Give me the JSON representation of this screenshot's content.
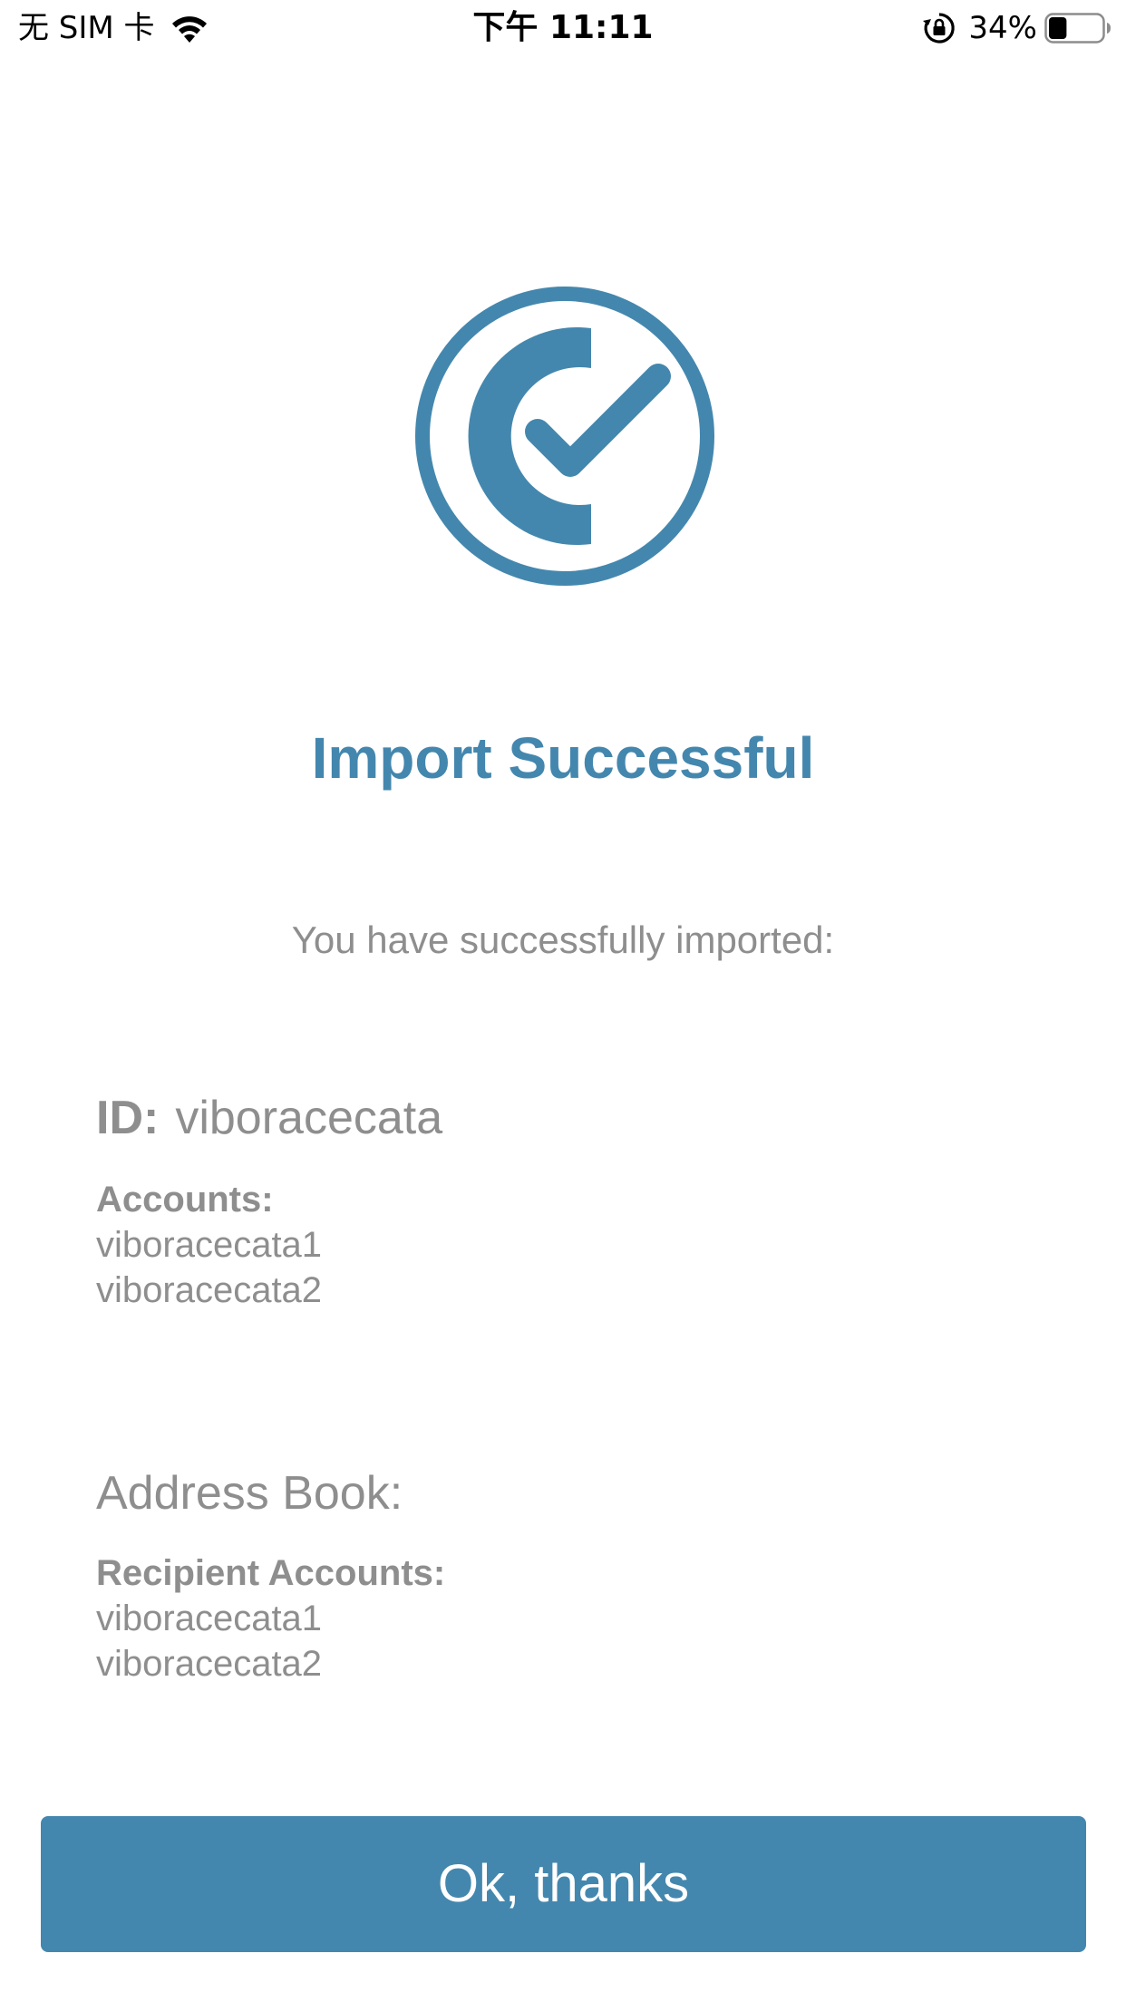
{
  "status_bar": {
    "carrier": "无 SIM 卡",
    "time": "下午 11:11",
    "battery_percent": "34%",
    "battery_level": 0.34,
    "icons": [
      "wifi-icon",
      "rotation-lock-icon",
      "battery-icon"
    ]
  },
  "success": {
    "icon": "check-circle-icon",
    "accent_color": "#4487AE",
    "title": "Import Successful",
    "subtitle": "You have successfully imported:"
  },
  "identity": {
    "id_label": "ID:",
    "id_value": "viboracecata",
    "accounts_label": "Accounts:",
    "accounts": [
      "viboracecata1",
      "viboracecata2"
    ]
  },
  "address_book": {
    "title": "Address Book:",
    "recipients_label": "Recipient Accounts:",
    "recipients": [
      "viboracecata1",
      "viboracecata2"
    ]
  },
  "actions": {
    "ok_label": "Ok, thanks"
  }
}
